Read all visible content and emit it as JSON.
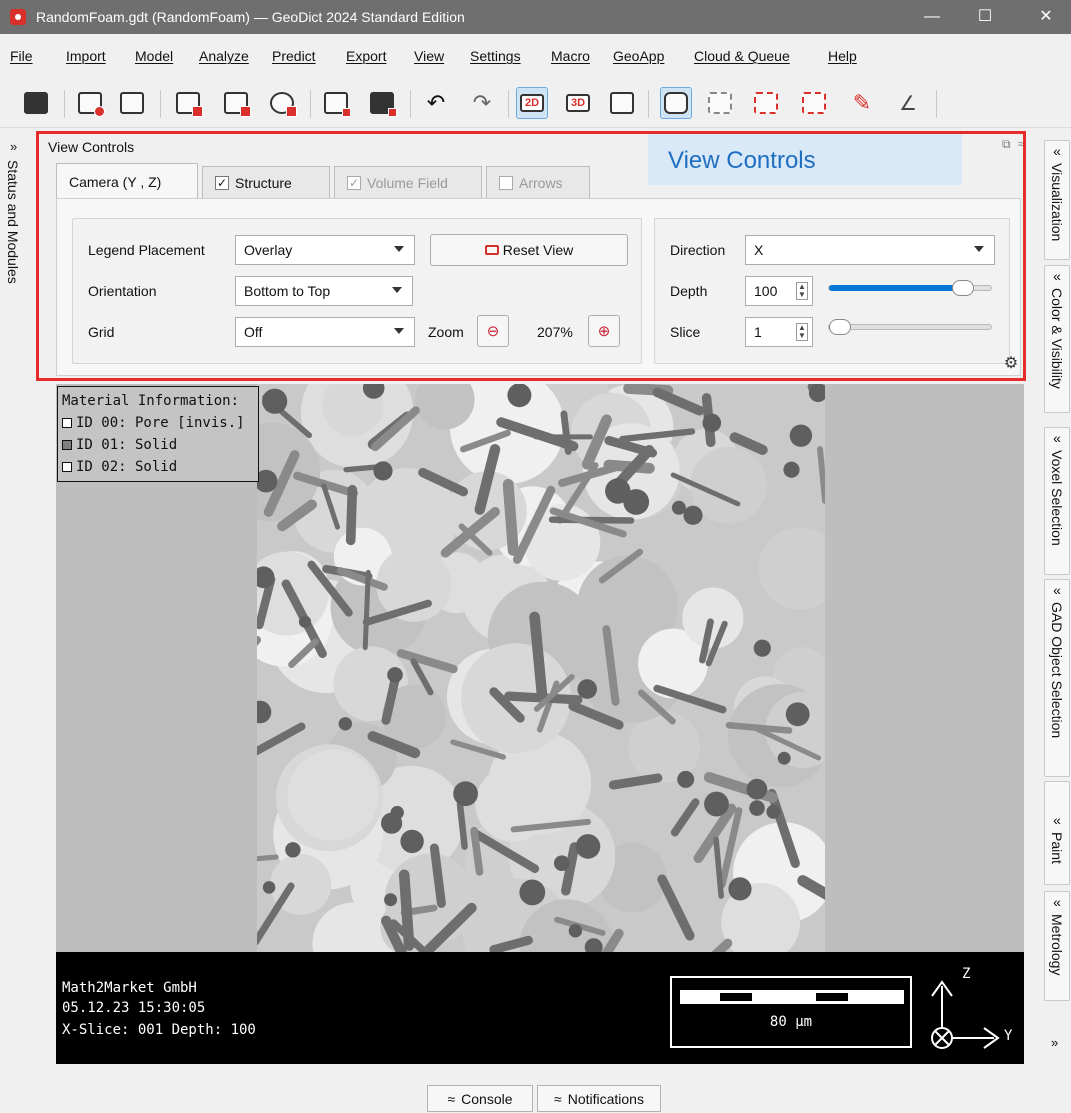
{
  "window": {
    "title": "RandomFoam.gdt (RandomFoam) — GeoDict 2024 Standard Edition",
    "minimize_glyph": "—",
    "maximize_glyph": "☐",
    "close_glyph": "✕"
  },
  "menu": [
    {
      "label": "File"
    },
    {
      "label": "Import"
    },
    {
      "label": "Model"
    },
    {
      "label": "Analyze"
    },
    {
      "label": "Predict"
    },
    {
      "label": "Export"
    },
    {
      "label": "View"
    },
    {
      "label": "Settings"
    },
    {
      "label": "Macro"
    },
    {
      "label": "GeoApp"
    },
    {
      "label": "Cloud & Queue"
    },
    {
      "label": "Help"
    }
  ],
  "toolbar": {
    "view_2d": "2D",
    "view_3d": "3D",
    "icons": [
      "open-folder-icon",
      "structure-icon",
      "report-icon",
      "cube-icon",
      "image-icon",
      "play-icon",
      "table-icon",
      "database-icon",
      "undo-icon",
      "redo-icon",
      "2d-icon",
      "3d-icon",
      "pointer-icon",
      "select-icon",
      "select-region-icon",
      "check-icon",
      "check-region-icon",
      "paint-icon",
      "measure-icon"
    ]
  },
  "left_dock": {
    "chevron": "»",
    "label": "Status and Modules"
  },
  "right_dock": {
    "tabs": [
      {
        "chevron": "«",
        "label": "Visualization"
      },
      {
        "chevron": "«",
        "label": "Color & Visibility"
      },
      {
        "chevron": "«",
        "label": "Voxel Selection"
      },
      {
        "chevron": "«",
        "label": "GAD Object Selection"
      },
      {
        "chevron": "«",
        "label": "Paint"
      },
      {
        "chevron": "«",
        "label": "Metrology"
      }
    ],
    "bottom_chevron": "»"
  },
  "view_controls": {
    "title": "View Controls",
    "callout": "View Controls",
    "tabs": [
      {
        "label": "Camera (Y , Z)",
        "checked": null,
        "enabled": true
      },
      {
        "label": "Structure",
        "checked": true,
        "enabled": true
      },
      {
        "label": "Volume Field",
        "checked": true,
        "enabled": false
      },
      {
        "label": "Arrows",
        "checked": false,
        "enabled": false
      }
    ],
    "check_mark": "✓",
    "legend_placement_label": "Legend Placement",
    "legend_placement_value": "Overlay",
    "orientation_label": "Orientation",
    "orientation_value": "Bottom to Top",
    "grid_label": "Grid",
    "grid_value": "Off",
    "reset_view_label": "Reset View",
    "zoom_label": "Zoom",
    "zoom_value": "207%",
    "direction_label": "Direction",
    "direction_value": "X",
    "depth_label": "Depth",
    "depth_value": "100",
    "depth_fraction": 0.88,
    "slice_label": "Slice",
    "slice_value": "1",
    "slice_fraction": 0.0
  },
  "viewer": {
    "material_info": {
      "title": "Material Information:",
      "items": [
        {
          "label": "ID 00: Pore [invis.]",
          "color": "#ffffff"
        },
        {
          "label": "ID 01: Solid",
          "color": "#808080"
        },
        {
          "label": "ID 02: Solid",
          "color": "#ffffff"
        }
      ]
    },
    "info_lines": [
      "Math2Market GmbH",
      "05.12.23 15:30:05",
      "X-Slice: 001 Depth: 100"
    ],
    "scale_label": "80 µm",
    "axis_z": "Z",
    "axis_y": "Y"
  },
  "bottom": {
    "console": "Console",
    "notifications": "Notifications",
    "chevron": "≈"
  },
  "colors": {
    "accent_red": "#e52b2b",
    "callout_bg": "#d9e9f7",
    "callout_text": "#1e6fc1",
    "slider_fill": "#0a78d7"
  }
}
